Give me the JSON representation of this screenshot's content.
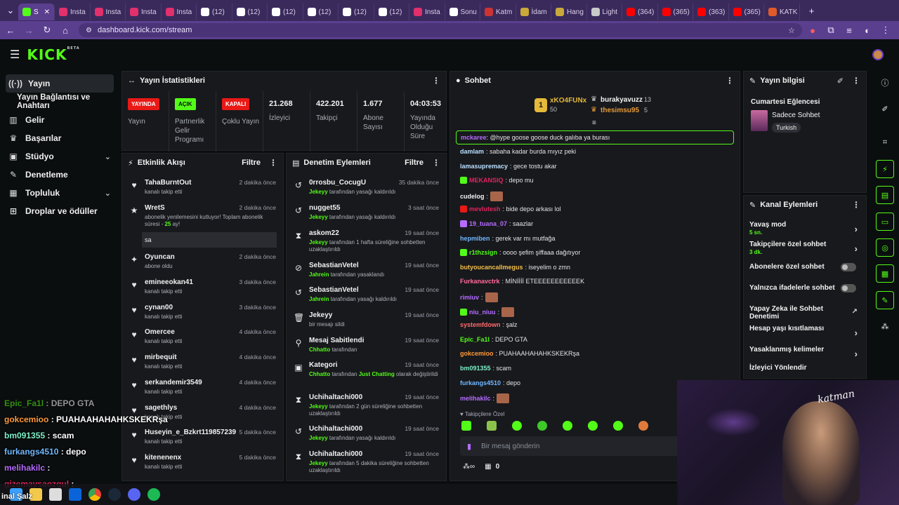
{
  "browser": {
    "tabs": [
      {
        "label": "S",
        "color": "#53fc18",
        "active": true
      },
      {
        "label": "Insta",
        "color": "#e1306c"
      },
      {
        "label": "Insta",
        "color": "#e1306c"
      },
      {
        "label": "Insta",
        "color": "#e1306c"
      },
      {
        "label": "Insta",
        "color": "#e1306c"
      },
      {
        "label": "(12)",
        "color": "#ffffff"
      },
      {
        "label": "(12)",
        "color": "#ffffff"
      },
      {
        "label": "(12)",
        "color": "#ffffff"
      },
      {
        "label": "(12)",
        "color": "#ffffff"
      },
      {
        "label": "(12)",
        "color": "#ffffff"
      },
      {
        "label": "(12)",
        "color": "#ffffff"
      },
      {
        "label": "Insta",
        "color": "#e1306c"
      },
      {
        "label": "Sonu",
        "color": "#ffffff"
      },
      {
        "label": "Katm",
        "color": "#cc3333"
      },
      {
        "label": "İdam",
        "color": "#c9a93a"
      },
      {
        "label": "Hang",
        "color": "#c9a93a"
      },
      {
        "label": "Light",
        "color": "#c9c9c9"
      },
      {
        "label": "(364)",
        "color": "#ff0000"
      },
      {
        "label": "(365)",
        "color": "#ff0000"
      },
      {
        "label": "(363)",
        "color": "#ff0000"
      },
      {
        "label": "(365)",
        "color": "#ff0000"
      },
      {
        "label": "KATK",
        "color": "#e05a2a"
      }
    ],
    "url": "dashboard.kick.com/stream"
  },
  "header": {
    "logo": "KICK",
    "logo_sup": "BETA"
  },
  "sidebar": {
    "items": [
      {
        "label": "Yayın",
        "icon": "broadcast-icon"
      },
      {
        "label": "Yayın Bağlantısı ve Anahtarı"
      },
      {
        "label": "Gelir",
        "icon": "chart-icon"
      },
      {
        "label": "Başarılar",
        "icon": "trophy-icon"
      },
      {
        "label": "Stüdyo",
        "icon": "studio-icon"
      },
      {
        "label": "Denetleme",
        "icon": "wrench-icon"
      },
      {
        "label": "Topluluk",
        "icon": "community-icon"
      },
      {
        "label": "Droplar ve ödüller",
        "icon": "gift-icon"
      }
    ]
  },
  "stats": {
    "title": "Yayın İstatistikleri",
    "badges": [
      {
        "badge": "YAYINDA",
        "label": "Yayın",
        "color": "#e91916"
      },
      {
        "badge": "AÇIK",
        "label": "Partnerlik Gelir Programı",
        "color": "#53fc18"
      },
      {
        "badge": "KAPALI",
        "label": "Çoklu Yayın",
        "color": "#e91916"
      }
    ],
    "numbers": [
      {
        "value": "21.268",
        "label": "İzleyici"
      },
      {
        "value": "422.201",
        "label": "Takipçi"
      },
      {
        "value": "1.677",
        "label": "Abone Sayısı"
      },
      {
        "value": "04:03:53",
        "label": "Yayında Olduğu Süre"
      }
    ]
  },
  "activity": {
    "title": "Etkinlik Akışı",
    "filter": "Filtre",
    "items": [
      {
        "name": "TahaBurntOut",
        "sub": "kanalı takip etti",
        "time": "2 dakika önce",
        "icon": "heart-icon"
      },
      {
        "name": "WretS",
        "sub_pre": "abonelik yenilemesini kutluyor! Toplam abonelik süresi - ",
        "sub_num": "25",
        "sub_post": " ay!",
        "time": "2 dakika önce",
        "icon": "star-icon",
        "reply": "sa"
      },
      {
        "name": "Oyuncan",
        "sub": "abone oldu",
        "time": "2 dakika önce",
        "icon": "sparkle-icon"
      },
      {
        "name": "emineeokan41",
        "sub": "kanalı takip etti",
        "time": "3 dakika önce",
        "icon": "heart-icon"
      },
      {
        "name": "cynan00",
        "sub": "kanalı takip etti",
        "time": "3 dakika önce",
        "icon": "heart-icon"
      },
      {
        "name": "Omercee",
        "sub": "kanalı takip etti",
        "time": "4 dakika önce",
        "icon": "heart-icon"
      },
      {
        "name": "mirbequit",
        "sub": "kanalı takip etti",
        "time": "4 dakika önce",
        "icon": "heart-icon"
      },
      {
        "name": "serkandemir3549",
        "sub": "kanalı takip etti",
        "time": "4 dakika önce",
        "icon": "heart-icon"
      },
      {
        "name": "sagethlys",
        "sub": "kanalı takip etti",
        "time": "4 dakika önce",
        "icon": "heart-icon"
      },
      {
        "name": "Huseyin_e_Bzkrt119857239",
        "sub": "kanalı takip etti",
        "time": "5 dakika önce",
        "icon": "heart-icon"
      },
      {
        "name": "kitenenenx",
        "sub": "kanalı takip etti",
        "time": "5 dakika önce",
        "icon": "heart-icon"
      }
    ]
  },
  "moderation": {
    "title": "Denetim Eylemleri",
    "filter": "Filtre",
    "items": [
      {
        "name": "0rrosbu_CocugU",
        "mod": "Jekeyy",
        "text": " tarafından yasağı kaldırıldı",
        "time": "35 dakika önce",
        "icon": "undo-icon"
      },
      {
        "name": "nugget55",
        "mod": "Jekeyy",
        "text": " tarafından yasağı kaldırıldı",
        "time": "3 saat önce",
        "icon": "undo-icon"
      },
      {
        "name": "askom22",
        "mod": "Jekeyy",
        "text": " tarafından 1 hafta süreliğine sohbetten uzaklaştırıldı",
        "time": "19 saat önce",
        "icon": "hourglass-icon"
      },
      {
        "name": "SebastianVetel",
        "mod": "Jahrein",
        "text": " tarafından yasaklandı",
        "time": "19 saat önce",
        "icon": "ban-icon"
      },
      {
        "name": "SebastianVetel",
        "mod": "Jahrein",
        "text": " tarafından yasağı kaldırıldı",
        "time": "19 saat önce",
        "icon": "undo-icon"
      },
      {
        "name": "Jekeyy",
        "mod": "",
        "text": "bir mesajı sildi",
        "time": "19 saat önce",
        "icon": "trash-icon"
      },
      {
        "name": "Mesaj Sabitlendi",
        "mod": "Chhatto",
        "text": " tarafından",
        "time": "19 saat önce",
        "icon": "pin-icon"
      },
      {
        "name": "Kategori",
        "mod": "Chhatto",
        "text": " tarafından ",
        "mod2": "Just Chatting",
        "text2": " olarak değiştirildi",
        "time": "19 saat önce",
        "icon": "category-icon"
      },
      {
        "name": "Uchihaltachi000",
        "mod": "Jekeyy",
        "text": " tarafından 2 gün süreliğine sohbetten uzaklaştırıldı",
        "time": "19 saat önce",
        "icon": "hourglass-icon"
      },
      {
        "name": "Uchihaltachi000",
        "mod": "Jekeyy",
        "text": " tarafından yasağı kaldırıldı",
        "time": "19 saat önce",
        "icon": "undo-icon"
      },
      {
        "name": "Uchihaltachi000",
        "mod": "Jekeyy",
        "text": " tarafından 5 dakika süreliğine sohbetten uzaklaştırıldı",
        "time": "19 saat önce",
        "icon": "hourglass-icon"
      }
    ]
  },
  "chat": {
    "title": "Sohbet",
    "leaderboard": [
      {
        "rank": "1",
        "name": "xKO4FUNx",
        "count": "50"
      },
      {
        "name": "burakyavuzz",
        "count": "13"
      },
      {
        "name": "thesimsu95",
        "count": "5"
      }
    ],
    "pinned": {
      "user": "mckaree",
      "text": ": @hype goose goose duck galıba ya burası"
    },
    "messages": [
      {
        "user": "damlam",
        "color": "#b8e0ff",
        "text": ": sabaha kadar burda mıyız peki"
      },
      {
        "user": "lamasupremacy",
        "color": "#b8e0ff",
        "text": ": gece tostu akar"
      },
      {
        "user": "MEKANSIQ",
        "color": "#e0245e",
        "text": ": depo mu",
        "badge": "#53fc18"
      },
      {
        "user": "cudelog",
        "color": "#f2f2f2",
        "text": ":",
        "emote": true
      },
      {
        "user": "mevlutesh",
        "color": "#e0245e",
        "text": ": bide depo arkası lol",
        "badge": "#e91916"
      },
      {
        "user": "19_tuana_07",
        "color": "#b56cff",
        "text": ": saazlar",
        "badge": "#b56cff"
      },
      {
        "user": "hepmiben",
        "color": "#6fb8ff",
        "text": ": gerek var mı mutfağa"
      },
      {
        "user": "r1thzsign",
        "color": "#53fc18",
        "text": ": oooo şefim şiffaaa dağıtıyor",
        "badge": "#53fc18"
      },
      {
        "user": "butyoucancallmegus",
        "color": "#f5c04a",
        "text": ": iseyelim o zmn"
      },
      {
        "user": "Furkanavctrk",
        "color": "#ff6b9a",
        "text": ": MİNİİİİ ETEEEEEEEEEEEK"
      },
      {
        "user": "rimiuv",
        "color": "#b56cff",
        "text": ":",
        "emote": true
      },
      {
        "user": "niu_niuu",
        "color": "#b56cff",
        "text": ":",
        "emote": true,
        "badge": "#53fc18"
      },
      {
        "user": "systemfdown",
        "color": "#ff6b6b",
        "text": ": şalz"
      },
      {
        "user": "Epic_Fa1l",
        "color": "#53fc18",
        "text": ": DEPO GTA"
      },
      {
        "user": "gokcemioo",
        "color": "#ff9a3c",
        "text": ": PUAHAAHAHAHKSKEKRşa"
      },
      {
        "user": "bm091355",
        "color": "#7ef0c8",
        "text": ": scam"
      },
      {
        "user": "furkangs4510",
        "color": "#6fb8ff",
        "text": ": depo"
      },
      {
        "user": "melihakilc",
        "color": "#b56cff",
        "text": ":",
        "emote": true
      }
    ],
    "followers_only": "Takipçilere Özel",
    "input_placeholder": "Bir mesaj gönderin",
    "footer_count": "0"
  },
  "stream_info": {
    "title": "Yayın bilgisi",
    "stream_title": "Cumartesi Eğlencesi",
    "category": "Sadece Sohbet",
    "tag": "Turkish"
  },
  "channel_actions": {
    "title": "Kanal Eylemleri",
    "items": [
      {
        "label": "Yavaş mod",
        "sub": "5 sn.",
        "kind": "chevron"
      },
      {
        "label": "Takipçilere özel sohbet",
        "sub": "3 dk.",
        "kind": "chevron"
      },
      {
        "label": "Abonelere özel sohbet",
        "kind": "toggle"
      },
      {
        "label": "Yalnızca ifadelerle sohbet",
        "kind": "toggle"
      },
      {
        "label": "Yapay Zeka ile Sohbet Denetimi",
        "kind": "external"
      },
      {
        "label": "Hesap yaşı kısıtlaması",
        "kind": "chevron"
      },
      {
        "label": "Yasaklanmış kelimeler",
        "kind": "chevron"
      },
      {
        "label": "İzleyici Yönlendir",
        "kind": "none"
      }
    ]
  },
  "overlay": {
    "lines": [
      {
        "user": "Epic_Fa1l",
        "text": " : DEPO GTA",
        "color": "#53fc18"
      },
      {
        "user": "gokcemioo",
        "text": " : PUAHAAHAHAHKSKEKRşa",
        "color": "#ff9a3c"
      },
      {
        "user": "bm091355",
        "text": " : scam",
        "color": "#7ef0c8"
      },
      {
        "user": "furkangs4510",
        "text": " : depo",
        "color": "#6fb8ff"
      },
      {
        "user": "melihakilc",
        "text": " :",
        "color": "#b56cff"
      },
      {
        "user": "gizemaysaozgul",
        "text": " :",
        "color": "#e0245e"
      }
    ],
    "taskbar_text": "inal Şalz",
    "webcam_sign": "katman"
  }
}
